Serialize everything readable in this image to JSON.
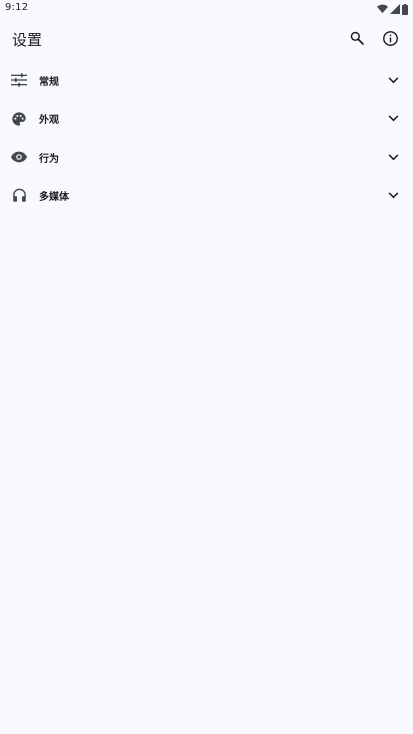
{
  "status_bar": {
    "time": "9:12",
    "icons": [
      "wifi-icon",
      "cell-signal-icon",
      "battery-icon"
    ]
  },
  "app_bar": {
    "title": "设置",
    "actions": [
      "search-icon",
      "info-icon"
    ]
  },
  "settings_groups": [
    {
      "label": "常规",
      "icon": "tune-icon"
    },
    {
      "label": "外观",
      "icon": "palette-icon"
    },
    {
      "label": "行为",
      "icon": "eye-icon"
    },
    {
      "label": "多媒体",
      "icon": "headphones-icon"
    }
  ],
  "colors": {
    "background": "#f8f9ff",
    "text": "#1b1b1f",
    "icon": "#44474e"
  }
}
